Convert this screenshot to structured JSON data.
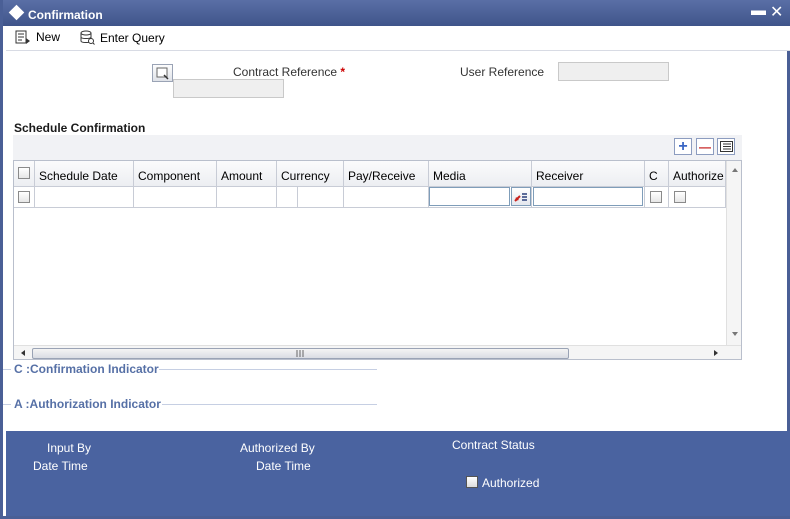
{
  "window": {
    "title": "Confirmation",
    "minimize_glyph": "▬",
    "close_glyph": "✕"
  },
  "toolbar": {
    "new_label": "New",
    "enter_query_label": "Enter Query"
  },
  "header": {
    "contract_reference_label": "Contract Reference",
    "required_marker": "*",
    "contract_reference_value": "",
    "user_reference_label": "User Reference",
    "user_reference_value": ""
  },
  "schedule": {
    "title": "Schedule Confirmation",
    "columns": [
      "Schedule Date",
      "Component",
      "Amount",
      "Currency",
      "Pay/Receive",
      "Media",
      "Receiver",
      "C",
      "Authorize"
    ],
    "rows": [
      {
        "schedule_date": "",
        "component": "",
        "amount": "",
        "currency": "",
        "pay_receive": "",
        "media": "",
        "receiver": "",
        "c": false,
        "authorize": false
      }
    ],
    "add_glyph": "+",
    "delete_glyph": "—"
  },
  "indicators": {
    "confirmation": "C :Confirmation Indicator",
    "authorization": "A :Authorization Indicator"
  },
  "footer": {
    "input_by_label": "Input By",
    "date_time_label_1": "Date Time",
    "authorized_by_label": "Authorized By",
    "date_time_label_2": "Date Time",
    "contract_status_label": "Contract Status",
    "authorized_label": "Authorized",
    "authorized_checked": false
  },
  "colors": {
    "title_bar": "#3f548a",
    "footer_bg": "#4a63a0",
    "indicator_text": "#5670a6",
    "required": "#cc0000"
  }
}
